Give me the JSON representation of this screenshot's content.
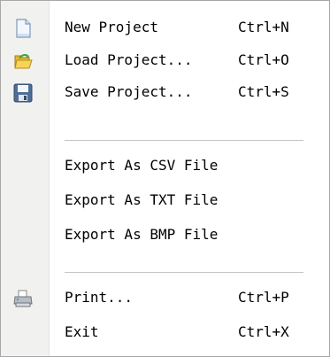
{
  "menu": {
    "items": [
      {
        "label": "New Project",
        "shortcut": "Ctrl+N",
        "icon": "new-document-icon"
      },
      {
        "label": "Load Project...",
        "shortcut": "Ctrl+O",
        "icon": "open-folder-icon"
      },
      {
        "label": "Save Project...",
        "shortcut": "Ctrl+S",
        "icon": "save-disk-icon"
      },
      {
        "label": "Export As CSV File"
      },
      {
        "label": "Export As TXT File"
      },
      {
        "label": "Export As BMP File"
      },
      {
        "label": "Print...",
        "shortcut": "Ctrl+P",
        "icon": "printer-icon"
      },
      {
        "label": "Exit",
        "shortcut": "Ctrl+X"
      }
    ]
  },
  "colors": {
    "background": "#ffffff",
    "gutter": "#f1f1ef",
    "border": "#a7a7a7",
    "separator": "#c5c5c5",
    "text": "#000000"
  }
}
